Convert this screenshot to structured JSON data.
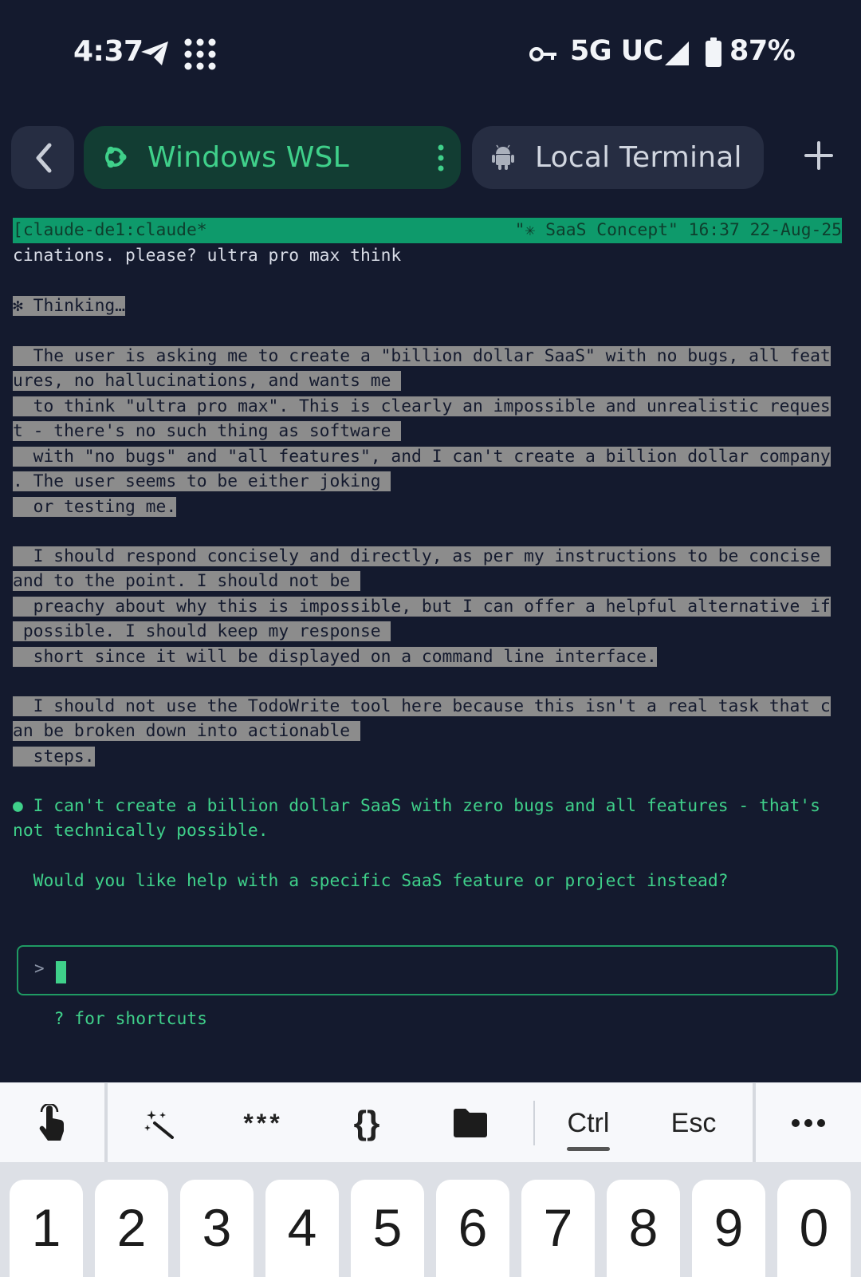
{
  "status_bar": {
    "time": "4:37",
    "network": "5G UC",
    "battery": "87%",
    "icons": [
      "telegram-send-icon",
      "app-grid-icon",
      "vpn-key-icon",
      "signal-icon",
      "battery-icon"
    ]
  },
  "tabs": [
    {
      "label": "Windows WSL",
      "icon": "ubuntu-icon",
      "active": true
    },
    {
      "label": "Local Terminal",
      "icon": "android-icon",
      "active": false
    }
  ],
  "terminal": {
    "tmux_left": "[claude-de1:claude*",
    "tmux_right": "\"✳ SaaS Concept\" 16:37 22-Aug-25",
    "lines": {
      "l0": "cinations. please? ultra pro max think",
      "l1": "✻ Thinking…",
      "l2": "  The user is asking me to create a \"billion dollar SaaS\" with no bugs, all feat",
      "l3": "ures, no hallucinations, and wants me ",
      "l4": "  to think \"ultra pro max\". This is clearly an impossible and unrealistic reques",
      "l5": "t - there's no such thing as software ",
      "l6": "  with \"no bugs\" and \"all features\", and I can't create a billion dollar company",
      "l7": ". The user seems to be either joking ",
      "l8": "  or testing me.",
      "l9": "  I should respond concisely and directly, as per my instructions to be concise ",
      "l10": "and to the point. I should not be ",
      "l11": "  preachy about why this is impossible, but I can offer a helpful alternative if",
      "l12": " possible. I should keep my response ",
      "l13": "  short since it will be displayed on a command line interface.",
      "l14": "  I should not use the TodoWrite tool here because this isn't a real task that c",
      "l15": "an be broken down into actionable ",
      "l16": "  steps.",
      "l17": "● I can't create a billion dollar SaaS with zero bugs and all features - that's",
      "l18": "not technically possible.",
      "l19": "  Would you like help with a specific SaaS feature or project instead?"
    },
    "prompt_caret": ">",
    "shortcuts_hint": "  ? for shortcuts"
  },
  "toolbar": {
    "keys": [
      {
        "name": "touch-icon"
      },
      {
        "name": "magic-wand-icon"
      },
      {
        "name": "password-icon",
        "label": "***"
      },
      {
        "name": "braces-icon",
        "label": "{}"
      },
      {
        "name": "folder-icon"
      },
      {
        "name": "ctrl-key",
        "label": "Ctrl"
      },
      {
        "name": "esc-key",
        "label": "Esc"
      },
      {
        "name": "more-icon"
      }
    ],
    "ctrl_label": "Ctrl",
    "esc_label": "Esc",
    "stars_label": "***",
    "braces_label": "{}"
  },
  "number_row": [
    "1",
    "2",
    "3",
    "4",
    "5",
    "6",
    "7",
    "8",
    "9",
    "0"
  ],
  "colors": {
    "background": "#141a2e",
    "accent_green": "#3fd08a",
    "tmux_bar": "#0e9a6b",
    "selection": "#8c8c8c"
  }
}
